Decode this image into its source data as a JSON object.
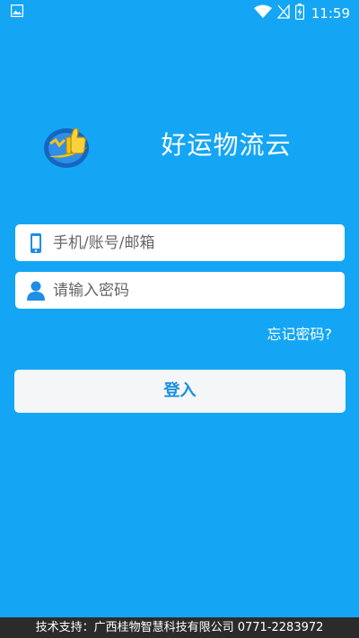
{
  "status_bar": {
    "time": "11:59",
    "icons": [
      "image-icon",
      "wifi-icon",
      "no-signal-icon",
      "battery-charging-icon"
    ]
  },
  "brand": {
    "title": "好运物流云",
    "logo_icon": "thumbs-up-logo"
  },
  "form": {
    "account_placeholder": "手机/账号/邮箱",
    "account_value": "",
    "account_icon": "phone-icon",
    "password_placeholder": "请输入密码",
    "password_value": "",
    "password_icon": "user-icon",
    "forgot_label": "忘记密码?",
    "login_label": "登入"
  },
  "footer": {
    "text": "技术支持：广西桂物智慧科技有限公司 0771-2283972"
  },
  "colors": {
    "background": "#14a6f5",
    "button_text": "#1a8fe0",
    "icon": "#1e8ee6",
    "footer_bg": "#2b2b2b"
  }
}
